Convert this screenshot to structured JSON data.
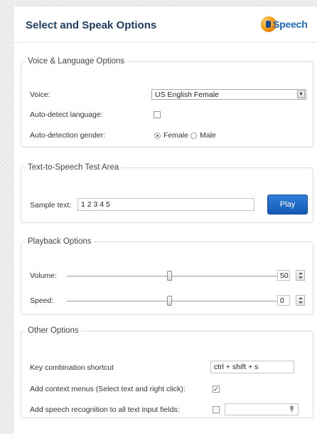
{
  "header": {
    "title": "Select and Speak Options",
    "logo_text": "Speech"
  },
  "voice_language": {
    "legend": "Voice & Language Options",
    "voice_label": "Voice:",
    "voice_value": "US English Female",
    "auto_detect_label": "Auto-detect language:",
    "auto_detect_checked": false,
    "gender_label": "Auto-detection gender:",
    "gender_options": [
      "Female",
      "Male"
    ],
    "gender_selected": "Female"
  },
  "tts_test": {
    "legend": "Text-to-Speech Test Area",
    "sample_label": "Sample text:",
    "sample_value": "1 2 3 4 5",
    "play_label": "Play"
  },
  "playback": {
    "legend": "Playback Options",
    "volume_label": "Volume:",
    "volume_value": "50",
    "speed_label": "Speed:",
    "speed_value": "0"
  },
  "other": {
    "legend": "Other Options",
    "shortcut_label": "Key combination shortcut",
    "shortcut_value": "ctrl + shift + s",
    "context_menu_label": "Add context menus (Select text and right click):",
    "context_menu_checked": true,
    "speech_recognition_label": "Add speech recognition to all text input fields:",
    "speech_recognition_checked": false
  },
  "colors": {
    "title": "#1e3a5f",
    "play_button": "#1f6bc9",
    "logo_blue": "#1a6bbf",
    "logo_orange": "#f39200"
  },
  "icons": {
    "logo": "ispeech-logo-icon",
    "dropdown": "chevron-down-icon",
    "mic": "microphone-icon"
  }
}
